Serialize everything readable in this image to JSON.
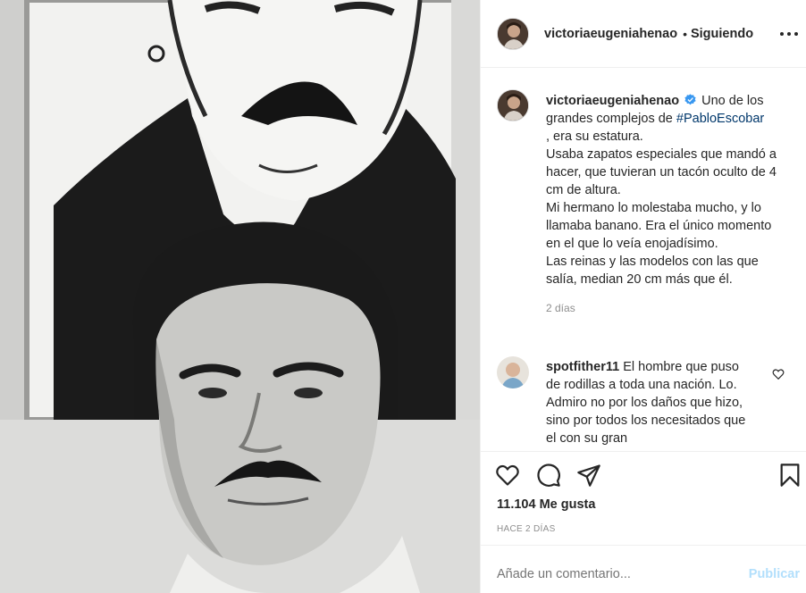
{
  "post": {
    "image_alt": "Fotografía en blanco y negro de Pablo Escobar frente a un retrato dibujado"
  },
  "header": {
    "username": "victoriaeugeniahenao",
    "separator": "•",
    "following_label": "Siguiendo",
    "more_icon": "more-horizontal-icon"
  },
  "caption": {
    "username": "victoriaeugeniahenao",
    "verified_icon": "verified-badge-icon",
    "text_before_hashtag": "Uno de los grandes complejos de",
    "hashtag": "#PabloEscobar",
    "lines": [
      ", era su estatura.",
      "Usaba zapatos especiales que mandó a hacer, que tuvieran un tacón oculto de 4 cm de altura.",
      "Mi hermano lo molestaba mucho, y lo llamaba banano. Era el único momento en el que lo veía enojadísimo.",
      "Las reinas y las modelos con las que salía, median 20 cm más que él."
    ],
    "time": "2 días"
  },
  "comment": {
    "username": "spotfither11",
    "text": "El hombre que puso de rodillas a toda una nación. Lo. Admiro no por los daños que hizo, sino por todos los necesitados que el con su gran"
  },
  "actions": {
    "like_icon": "heart-icon",
    "comment_icon": "comment-icon",
    "share_icon": "paper-plane-icon",
    "save_icon": "bookmark-icon",
    "likes": "11.104 Me gusta",
    "date": "HACE 2 DÍAS"
  },
  "add_comment": {
    "placeholder": "Añade un comentario...",
    "publish_label": "Publicar"
  },
  "colors": {
    "text": "#262626",
    "secondary": "#8e8e8e",
    "hashtag": "#00376b",
    "verified": "#3897f0",
    "publish_disabled": "#b2dffc",
    "border": "#efefef"
  }
}
